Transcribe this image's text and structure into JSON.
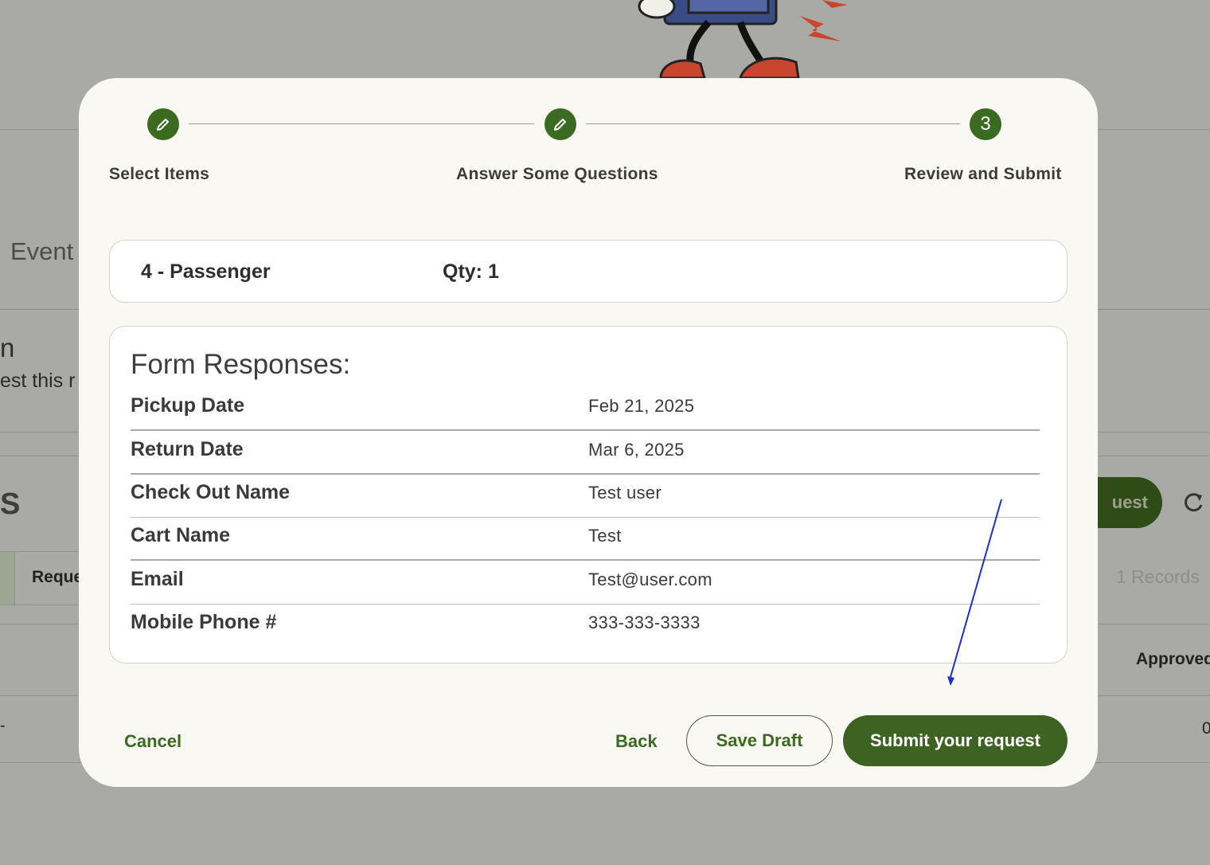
{
  "background": {
    "event_heading": "Event",
    "partial_heading": "n",
    "partial_text": "est this r",
    "section_letter": "S",
    "column_header": "Reque",
    "request_button_partial": "uest",
    "records_count": "1 Records",
    "approved_header": "Approved",
    "row_value": "0",
    "row_dash": "-"
  },
  "stepper": {
    "steps": [
      {
        "label": "Select Items",
        "icon": "pencil-icon",
        "state": "complete"
      },
      {
        "label": "Answer Some Questions",
        "icon": "pencil-icon",
        "state": "complete"
      },
      {
        "label": "Review and Submit",
        "number": "3",
        "state": "active"
      }
    ],
    "accent_color": "#3b6b20"
  },
  "item": {
    "name": "4 - Passenger",
    "qty": "Qty: 1"
  },
  "responses": {
    "title": "Form Responses:",
    "rows": [
      {
        "label": "Pickup Date",
        "value": "Feb 21, 2025"
      },
      {
        "label": "Return Date",
        "value": "Mar 6, 2025"
      },
      {
        "label": "Check Out Name",
        "value": "Test user"
      },
      {
        "label": "Cart Name",
        "value": "Test"
      },
      {
        "label": "Email",
        "value": "Test@user.com"
      },
      {
        "label": "Mobile Phone #",
        "value": "333-333-3333"
      }
    ]
  },
  "actions": {
    "cancel": "Cancel",
    "back": "Back",
    "save_draft": "Save Draft",
    "submit": "Submit your request"
  },
  "annotation": {
    "arrow_color": "#1a2fd6",
    "points_to": "submit-button"
  }
}
